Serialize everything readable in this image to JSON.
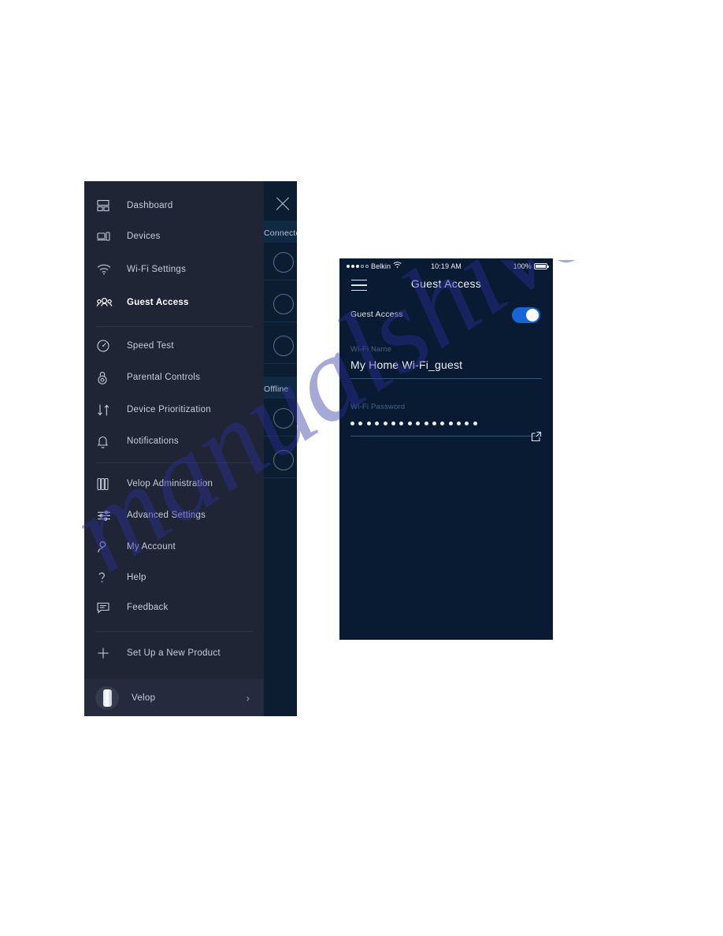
{
  "menu_screenshot": {
    "drawer": {
      "items": [
        {
          "label": "Dashboard",
          "icon": "dashboard-grid-icon",
          "active": false
        },
        {
          "label": "Devices",
          "icon": "devices-icon",
          "active": false
        },
        {
          "label": "Wi-Fi Settings",
          "icon": "wifi-icon",
          "active": false
        },
        {
          "label": "Guest Access",
          "icon": "guest-access-people-icon",
          "active": true
        },
        {
          "label": "Speed Test",
          "icon": "speedometer-icon",
          "active": false
        },
        {
          "label": "Parental Controls",
          "icon": "lock-icon",
          "active": false
        },
        {
          "label": "Device Prioritization",
          "icon": "up-down-arrows-icon",
          "active": false
        },
        {
          "label": "Notifications",
          "icon": "bell-icon",
          "active": false
        },
        {
          "label": "Velop Administration",
          "icon": "velop-node-icon",
          "active": false
        },
        {
          "label": "Advanced Settings",
          "icon": "sliders-icon",
          "active": false
        },
        {
          "label": "My Account",
          "icon": "person-icon",
          "active": false
        },
        {
          "label": "Help",
          "icon": "question-mark-icon",
          "active": false
        },
        {
          "label": "Feedback",
          "icon": "speech-bubble-icon",
          "active": false
        },
        {
          "label": "Set Up a New Product",
          "icon": "plus-icon",
          "active": false
        }
      ],
      "footer": {
        "label": "Velop",
        "avatar_icon": "velop-node-avatar",
        "chevron": "›"
      }
    },
    "background_panel": {
      "close_icon": "close-x-icon",
      "sections": [
        {
          "label": "Connected"
        },
        {
          "label": "Offline"
        }
      ]
    }
  },
  "phone_screenshot": {
    "status_bar": {
      "carrier": "Belkin",
      "wifi_icon": "wifi-icon",
      "time": "10:19 AM",
      "battery_percent": "100%",
      "battery_icon": "battery-full-icon"
    },
    "header": {
      "menu_icon": "hamburger-menu-icon",
      "title": "Guest Access"
    },
    "guest_access_row": {
      "label": "Guest Access",
      "toggle_on": true,
      "toggle_color": "#1565d8"
    },
    "wifi_name_field": {
      "label": "Wi-Fi Name",
      "value": "My Home Wi-Fi_guest"
    },
    "wifi_password_field": {
      "label": "Wi-Fi Password",
      "masked_dot_count": 16,
      "share_icon": "share-external-link-icon"
    }
  },
  "watermark": {
    "text": "manualshive.com",
    "color": "#2b2f9e"
  }
}
